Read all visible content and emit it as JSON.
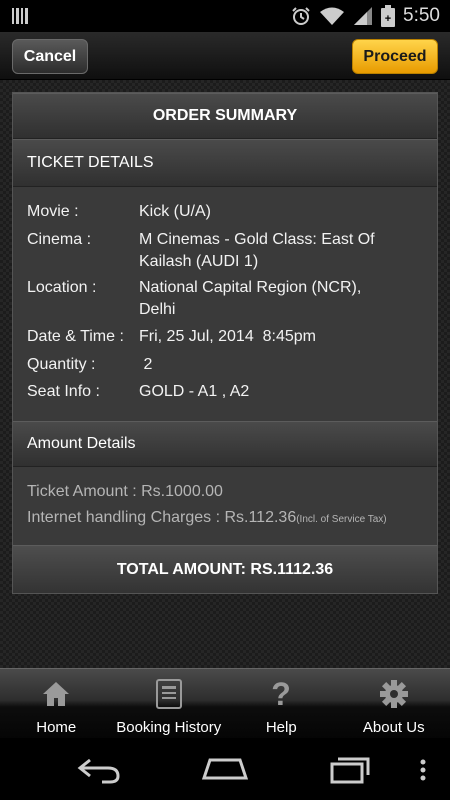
{
  "status_bar": {
    "time": "5:50",
    "icons": [
      "barcode-icon",
      "alarm-icon",
      "wifi-icon",
      "signal-icon",
      "battery-icon"
    ]
  },
  "action_bar": {
    "cancel_label": "Cancel",
    "proceed_label": "Proceed"
  },
  "order_summary": {
    "title": "ORDER SUMMARY",
    "ticket_section_title": "TICKET DETAILS",
    "details": [
      {
        "label": "Movie :",
        "value": "Kick (U/A)"
      },
      {
        "label": "Cinema :",
        "value": "M Cinemas - Gold Class: East Of Kailash (AUDI 1)"
      },
      {
        "label": "Location :",
        "value": "National Capital Region (NCR), Delhi"
      },
      {
        "label": "Date & Time :",
        "value": "Fri, 25 Jul, 2014  8:45pm"
      },
      {
        "label": "Quantity :",
        "value": " 2"
      },
      {
        "label": "Seat Info :",
        "value": "GOLD - A1 , A2"
      }
    ],
    "amount_section_title": "Amount Details",
    "ticket_amount": "Ticket Amount : Rs.1000.00",
    "handling_charges": "Internet handling Charges : Rs.112.36",
    "handling_note": "(Incl. of Service Tax)",
    "total": "TOTAL AMOUNT: RS.1112.36"
  },
  "tabs": [
    {
      "label": "Home",
      "icon": "home-icon"
    },
    {
      "label": "Booking History",
      "icon": "booking-history-icon"
    },
    {
      "label": "Help",
      "icon": "help-icon"
    },
    {
      "label": "About Us",
      "icon": "gear-icon"
    }
  ],
  "nav_icons": [
    "back-icon",
    "home-nav-icon",
    "recents-icon",
    "menu-icon"
  ],
  "colors": {
    "proceed_accent": "#f5b800",
    "background": "#1c1c1c",
    "card": "#3a3a3a"
  }
}
